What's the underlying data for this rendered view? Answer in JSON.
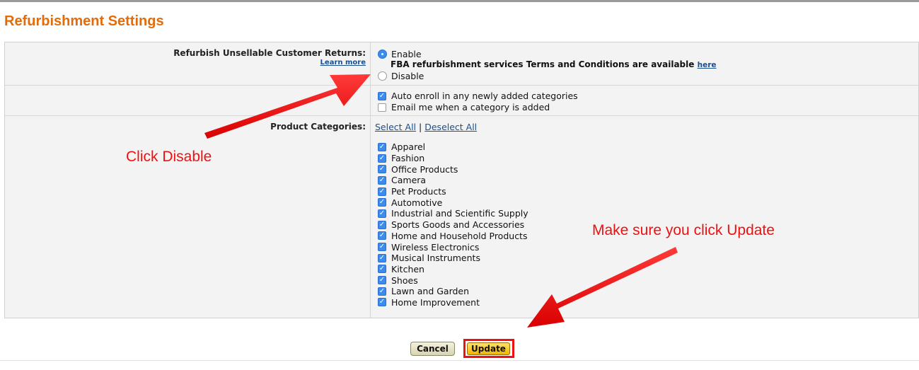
{
  "section_title": "Refurbishment Settings",
  "refurbish": {
    "label": "Refurbish Unsellable Customer Returns:",
    "learn_more": "Learn more",
    "options": [
      {
        "label": "Enable",
        "selected": true
      },
      {
        "label": "Disable",
        "selected": false
      }
    ],
    "terms_text": "FBA refurbishment services Terms and Conditions are available",
    "terms_link": "here"
  },
  "notifications": [
    {
      "label": "Auto enroll in any newly added categories",
      "checked": true
    },
    {
      "label": "Email me when a category is added",
      "checked": false
    }
  ],
  "categories": {
    "label": "Product Categories:",
    "select_all": "Select All",
    "separator": "|",
    "deselect_all": "Deselect All",
    "items": [
      {
        "label": "Apparel",
        "checked": true
      },
      {
        "label": "Fashion",
        "checked": true
      },
      {
        "label": "Office Products",
        "checked": true
      },
      {
        "label": "Camera",
        "checked": true
      },
      {
        "label": "Pet Products",
        "checked": true
      },
      {
        "label": "Automotive",
        "checked": true
      },
      {
        "label": "Industrial and Scientific Supply",
        "checked": true
      },
      {
        "label": "Sports Goods and Accessories",
        "checked": true
      },
      {
        "label": "Home and Household Products",
        "checked": true
      },
      {
        "label": "Wireless Electronics",
        "checked": true
      },
      {
        "label": "Musical Instruments",
        "checked": true
      },
      {
        "label": "Kitchen",
        "checked": true
      },
      {
        "label": "Shoes",
        "checked": true
      },
      {
        "label": "Lawn and Garden",
        "checked": true
      },
      {
        "label": "Home Improvement",
        "checked": true
      }
    ]
  },
  "buttons": {
    "cancel": "Cancel",
    "update": "Update"
  },
  "annotations": {
    "click_disable": "Click Disable",
    "click_update": "Make sure you click Update"
  },
  "colors": {
    "title": "#e36c0a",
    "link": "#1a4f8f",
    "checkbox": "#3b8cf0",
    "annotation": "#ee1111",
    "update_button": "#f0b400"
  },
  "icons": {
    "checkbox_checked": "check-icon"
  }
}
